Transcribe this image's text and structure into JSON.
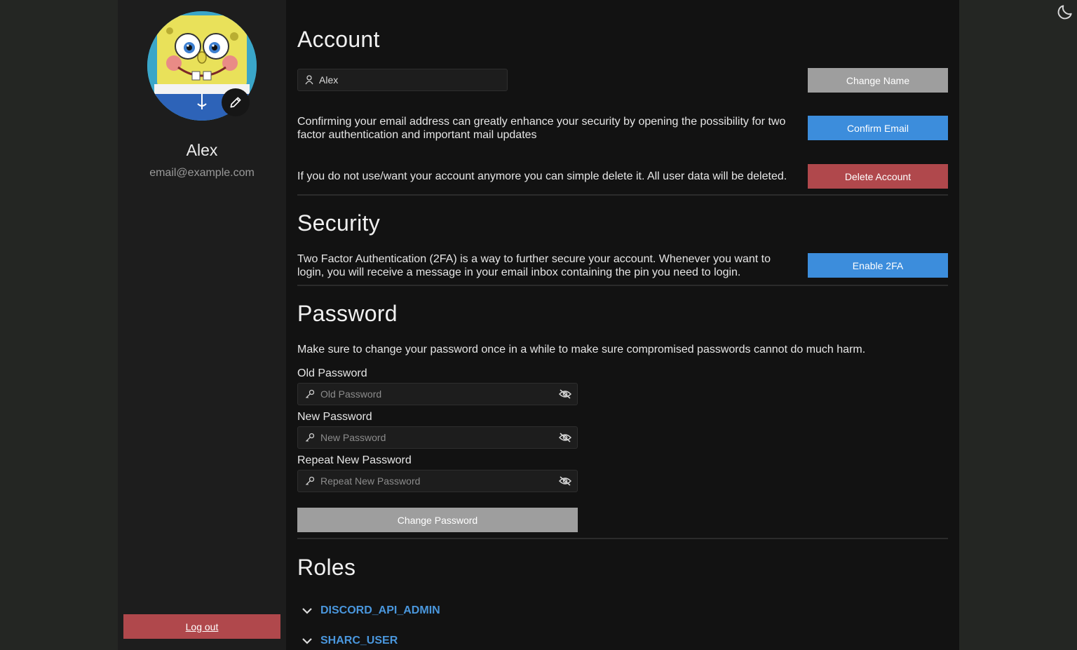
{
  "colors": {
    "accent_blue": "#3c8ddc",
    "danger_red": "#b0484c",
    "neutral_gray": "#9e9e9e",
    "role_link": "#4a97dd"
  },
  "profile": {
    "name": "Alex",
    "email": "email@example.com",
    "logout_label": "Log out"
  },
  "account": {
    "title": "Account",
    "name_value": "Alex",
    "change_name_label": "Change Name",
    "confirm_email_text": "Confirming your email address can greatly enhance your security by opening the possibility for two factor authentication and important mail updates",
    "confirm_email_label": "Confirm Email",
    "delete_text": "If you do not use/want your account anymore you can simple delete it. All user data will be deleted.",
    "delete_label": "Delete Account"
  },
  "security": {
    "title": "Security",
    "twofa_text": "Two Factor Authentication (2FA) is a way to further secure your account. Whenever you want to login, you will receive a message in your email inbox containing the pin you need to login.",
    "enable_label": "Enable 2FA"
  },
  "password": {
    "title": "Password",
    "description": "Make sure to change your password once in a while to make sure compromised passwords cannot do much harm.",
    "old_label": "Old Password",
    "old_placeholder": "Old Password",
    "new_label": "New Password",
    "new_placeholder": "New Password",
    "repeat_label": "Repeat New Password",
    "repeat_placeholder": "Repeat New Password",
    "submit_label": "Change Password"
  },
  "roles": {
    "title": "Roles",
    "items": [
      {
        "name": "DISCORD_API_ADMIN"
      },
      {
        "name": "SHARC_USER"
      }
    ]
  }
}
